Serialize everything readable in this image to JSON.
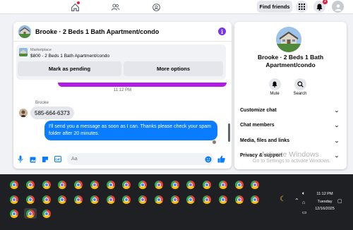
{
  "topnav": {
    "find_friends": "Find friends",
    "notification_count": "2"
  },
  "chat": {
    "title": "Brooke · 2 Beds 1 Bath Apartment/condo",
    "listing": {
      "source": "Marketplace",
      "description": "$800 - 2 Beds 1 Bath Apartment/condo",
      "pending_button": "Mark as pending",
      "more_button": "More options"
    },
    "timestamp": "11:12 PM",
    "sender_name": "Brooke",
    "incoming_message": "585-664-6373",
    "outgoing_message": "I'll send you a message as soon as I can. Thanks please check your spam folder after 20 minutes.",
    "compose_placeholder": "Aa",
    "accent_color": "#0a7cff"
  },
  "panel": {
    "name": "Brooke · 2 Beds 1 Bath Apartment/condo",
    "mute": "Mute",
    "search": "Search",
    "rows": [
      "Customize chat",
      "Chat members",
      "Media, files and links",
      "Privacy & support"
    ]
  },
  "watermark": {
    "line1": "Activate Windows",
    "line2": "Go to Settings to activate Windows."
  },
  "taskbar": {
    "time": "11:12 PM",
    "day": "Tuesday",
    "date": "12/16/2025"
  }
}
